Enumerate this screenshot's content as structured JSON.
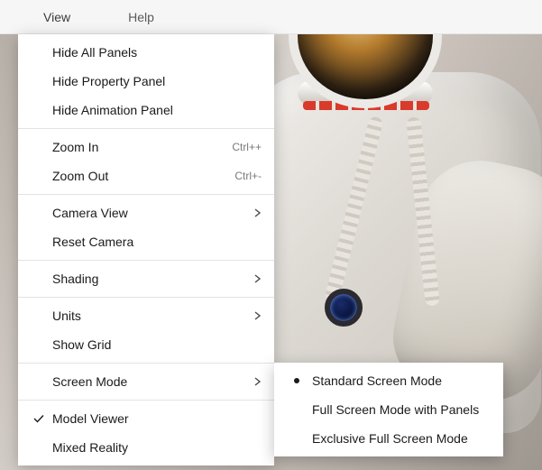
{
  "menubar": {
    "view": "View",
    "help": "Help"
  },
  "menu": {
    "hide_all_panels": "Hide All Panels",
    "hide_property_panel": "Hide Property Panel",
    "hide_animation_panel": "Hide Animation Panel",
    "zoom_in": "Zoom In",
    "zoom_in_accel": "Ctrl++",
    "zoom_out": "Zoom Out",
    "zoom_out_accel": "Ctrl+-",
    "camera_view": "Camera View",
    "reset_camera": "Reset Camera",
    "shading": "Shading",
    "units": "Units",
    "show_grid": "Show Grid",
    "screen_mode": "Screen Mode",
    "model_viewer": "Model Viewer",
    "mixed_reality": "Mixed Reality"
  },
  "submenu": {
    "standard": "Standard Screen Mode",
    "full_panels": "Full Screen Mode with Panels",
    "exclusive": "Exclusive Full Screen Mode"
  }
}
